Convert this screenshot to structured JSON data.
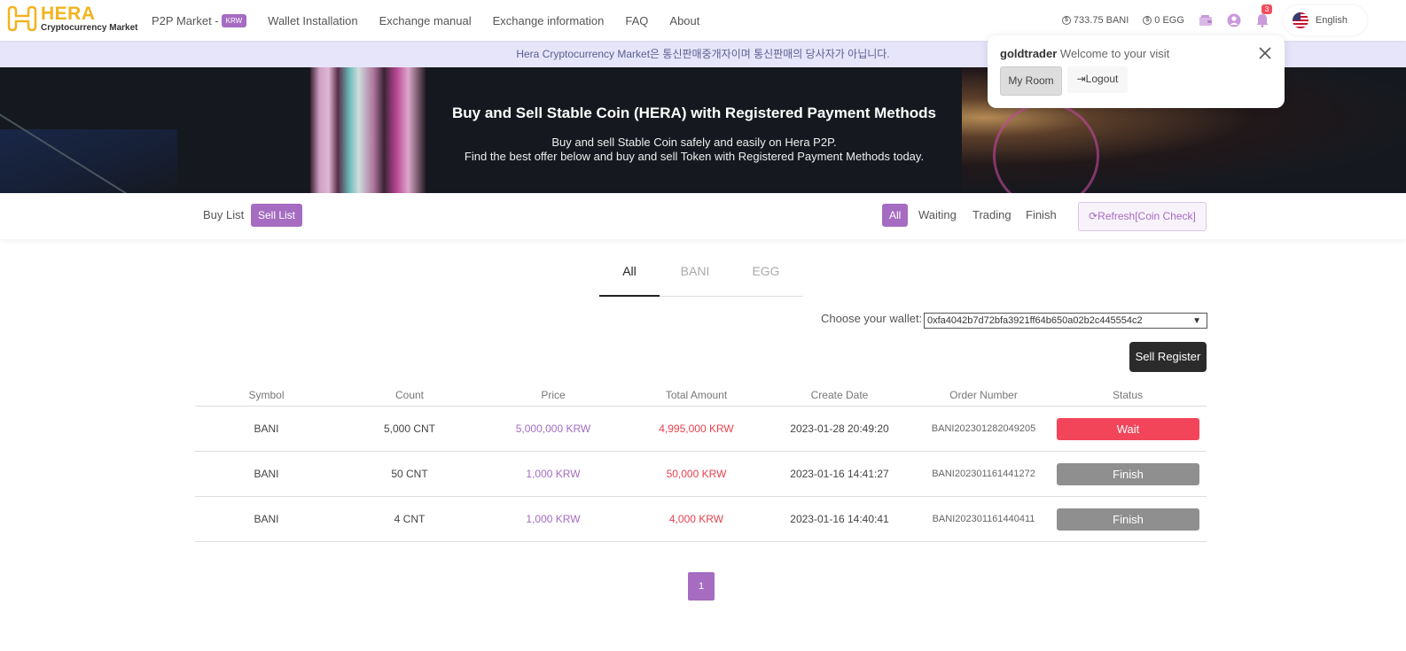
{
  "brand": {
    "name": "HERA",
    "subtitle": "Cryptocurrency Market",
    "color": "#f2b320",
    "accent": "#a56cc1"
  },
  "nav": {
    "p2p_label": "P2P Market -",
    "p2p_badge": "KRW",
    "wallet_installation": "Wallet Installation",
    "exchange_manual": "Exchange manual",
    "exchange_information": "Exchange information",
    "faq": "FAQ",
    "about": "About"
  },
  "header_right": {
    "bani_balance": "733.75 BANI",
    "egg_balance": "0 EGG",
    "notification_count": "3",
    "language": "English"
  },
  "notice": "Hera Cryptocurrency Market은 통신판매중개자이며 통신판매의 당사자가 아닙니다.",
  "banner": {
    "title": "Buy and Sell Stable Coin (HERA) with Registered Payment Methods",
    "line1": "Buy and sell Stable Coin safely and easily on Hera P2P.",
    "line2": "Find the best offer below and buy and sell Token with Registered Payment Methods today."
  },
  "filters": {
    "buy_list": "Buy List",
    "sell_list": "Sell List",
    "all": "All",
    "waiting": "Waiting",
    "trading": "Trading",
    "finish": "Finish",
    "refresh": "Refresh[Coin Check]"
  },
  "tabs": {
    "all": "All",
    "bani": "BANI",
    "egg": "EGG"
  },
  "wallet": {
    "label": "Choose your wallet:",
    "value": "0xfa4042b7d72bfa3921ff64b650a02b2c445554c2"
  },
  "sell_register": "Sell Register",
  "table": {
    "headers": [
      "Symbol",
      "Count",
      "Price",
      "Total Amount",
      "Create Date",
      "Order Number",
      "Status"
    ],
    "rows": [
      {
        "symbol": "BANI",
        "count": "5,000 CNT",
        "price": "5,000,000 KRW",
        "total": "4,995,000 KRW",
        "date": "2023-01-28 20:49:20",
        "order": "BANI202301282049205",
        "status": "Wait"
      },
      {
        "symbol": "BANI",
        "count": "50 CNT",
        "price": "1,000 KRW",
        "total": "50,000 KRW",
        "date": "2023-01-16 14:41:27",
        "order": "BANI202301161441272",
        "status": "Finish"
      },
      {
        "symbol": "BANI",
        "count": "4 CNT",
        "price": "1,000 KRW",
        "total": "4,000 KRW",
        "date": "2023-01-16 14:40:41",
        "order": "BANI202301161440411",
        "status": "Finish"
      }
    ]
  },
  "pagination": {
    "current": "1"
  },
  "popup": {
    "username": "goldtrader",
    "welcome": "Welcome to your visit",
    "my_room": "My Room",
    "logout": "Logout"
  }
}
